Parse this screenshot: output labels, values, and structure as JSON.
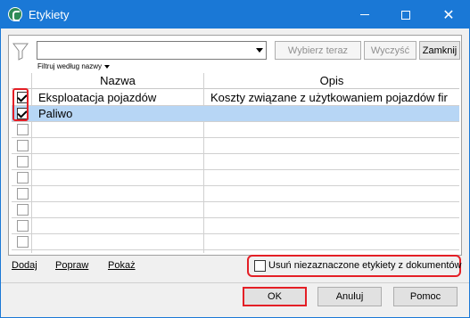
{
  "window": {
    "title": "Etykiety"
  },
  "toolbar": {
    "filter_value": "",
    "choose_now_label": "Wybierz teraz",
    "clear_label": "Wyczyść",
    "close_label": "Zamknij",
    "filter_mode_label": "Filtruj według nazwy"
  },
  "table": {
    "headers": {
      "name": "Nazwa",
      "description": "Opis"
    },
    "rows": [
      {
        "checked": true,
        "name": "Eksploatacja pojazdów",
        "description": "Koszty związane z użytkowaniem pojazdów fir",
        "selected": false
      },
      {
        "checked": true,
        "name": "Paliwo",
        "description": "",
        "selected": true
      },
      {
        "checked": false,
        "name": "",
        "description": "",
        "selected": false
      },
      {
        "checked": false,
        "name": "",
        "description": "",
        "selected": false
      },
      {
        "checked": false,
        "name": "",
        "description": "",
        "selected": false
      },
      {
        "checked": false,
        "name": "",
        "description": "",
        "selected": false
      },
      {
        "checked": false,
        "name": "",
        "description": "",
        "selected": false
      },
      {
        "checked": false,
        "name": "",
        "description": "",
        "selected": false
      },
      {
        "checked": false,
        "name": "",
        "description": "",
        "selected": false
      },
      {
        "checked": false,
        "name": "",
        "description": "",
        "selected": false
      }
    ]
  },
  "actions": {
    "add_label": "Dodaj",
    "edit_label": "Popraw",
    "show_label": "Pokaż",
    "remove_unchecked_label": "Usuń niezaznaczone etykiety z dokumentów",
    "remove_unchecked_checked": false
  },
  "footer": {
    "ok_label": "OK",
    "cancel_label": "Anuluj",
    "help_label": "Pomoc"
  },
  "colors": {
    "titlebar": "#1a78d6",
    "selected_row": "#b7d6f5",
    "highlight": "#e41f26"
  }
}
